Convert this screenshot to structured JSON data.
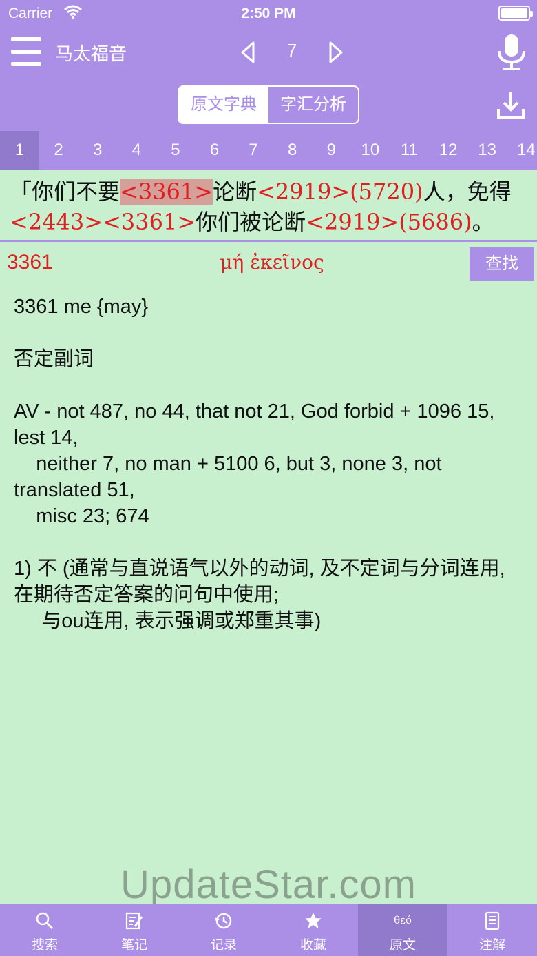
{
  "status_bar": {
    "carrier": "Carrier",
    "time": "2:50 PM"
  },
  "nav": {
    "book_title": "马太福音",
    "chapter": "7"
  },
  "segmented": {
    "left": "原文字典",
    "right": "字汇分析"
  },
  "verse_numbers": [
    "1",
    "2",
    "3",
    "4",
    "5",
    "6",
    "7",
    "8",
    "9",
    "10",
    "11",
    "12",
    "13",
    "14"
  ],
  "current_verse": {
    "line1": [
      {
        "t": "「你们不要",
        "k": "txt"
      },
      {
        "t": "<3361>",
        "k": "hl"
      },
      {
        "t": "论断",
        "k": "txt"
      },
      {
        "t": "<2919>(5720)",
        "k": "ref"
      },
      {
        "t": "人，免得",
        "k": "txt"
      }
    ],
    "line2": [
      {
        "t": "<2443><3361>",
        "k": "ref"
      },
      {
        "t": "你们被论断",
        "k": "txt"
      },
      {
        "t": "<2919>(5686)",
        "k": "ref"
      },
      {
        "t": "。",
        "k": "txt"
      }
    ]
  },
  "dictionary": {
    "code": "3361",
    "greek": "μή ἐκεῖνος",
    "search_label": "查找",
    "body_lines": [
      "3361 me {may}",
      "",
      "否定副词",
      "",
      "AV - not 487, no 44, that not 21, God forbid + 1096 15, lest 14,",
      "    neither 7, no man + 5100 6, but 3, none 3, not translated 51,",
      "    misc 23; 674",
      "",
      "1) 不 (通常与直说语气以外的动词, 及不定词与分词连用, 在期待否定答案的问句中使用;",
      "     与ou连用, 表示强调或郑重其事)"
    ]
  },
  "watermark": "UpdateStar.com",
  "tabbar": [
    {
      "label": "搜索",
      "icon": "search-icon"
    },
    {
      "label": "笔记",
      "icon": "note-icon"
    },
    {
      "label": "记录",
      "icon": "history-icon"
    },
    {
      "label": "收藏",
      "icon": "star-icon"
    },
    {
      "label": "原文",
      "icon": "theo-icon",
      "icon_text": "θεό",
      "active": true
    },
    {
      "label": "注解",
      "icon": "book-icon"
    }
  ],
  "colors": {
    "header": "#ab8fe6",
    "active": "#9179cc",
    "background": "#c8efce",
    "reference": "#e02020"
  }
}
